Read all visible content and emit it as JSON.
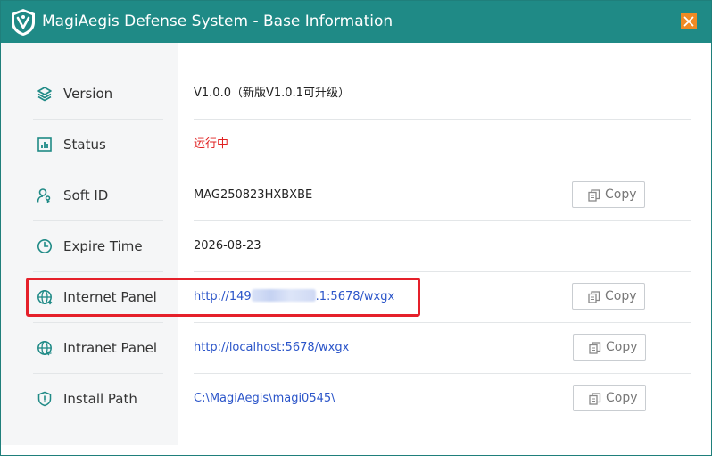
{
  "window": {
    "title": "MagiAegis Defense System - Base Information",
    "accent_color": "#1f8a86",
    "close_color": "#f08a24",
    "logo_icon": "shield-logo-icon"
  },
  "rows": [
    {
      "icon": "layers-icon",
      "label": "Version",
      "value": "V1.0.0（新版V1.0.1可升级）",
      "style": "plain",
      "copy": false
    },
    {
      "icon": "chart-icon",
      "label": "Status",
      "value": "运行中",
      "style": "red",
      "copy": false
    },
    {
      "icon": "user-key-icon",
      "label": "Soft ID",
      "value": "MAG250823HXBXBE",
      "style": "plain",
      "copy": true
    },
    {
      "icon": "clock-icon",
      "label": "Expire Time",
      "value": "2026-08-23",
      "style": "plain",
      "copy": false
    },
    {
      "icon": "globe-icon",
      "label": "Internet Panel",
      "value_prefix": "http://149",
      "value_suffix": ".1:5678/wxgx",
      "style": "link",
      "copy": true,
      "highlighted": true
    },
    {
      "icon": "globe-arrow-icon",
      "label": "Intranet Panel",
      "value": "http://localhost:5678/wxgx",
      "style": "link",
      "copy": true
    },
    {
      "icon": "shield-icon",
      "label": "Install Path",
      "value": "C:\\MagiAegis\\magi0545\\",
      "style": "link",
      "copy": true
    }
  ],
  "copy_label": "Copy",
  "colors": {
    "status_red": "#e02020",
    "link_blue": "#2b55c9",
    "highlight_red": "#e5202a",
    "icon_teal": "#1f8a86"
  }
}
